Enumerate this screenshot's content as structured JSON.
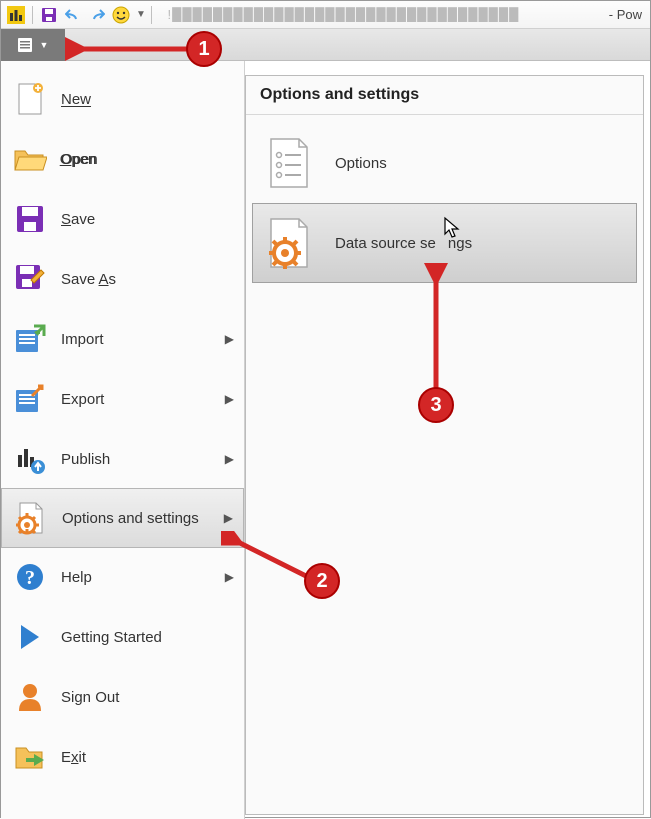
{
  "titlebar": {
    "right_text": "- Pow"
  },
  "menu": {
    "items": [
      {
        "label": "New"
      },
      {
        "label": "Open"
      },
      {
        "label": "Save"
      },
      {
        "label": "Save As"
      },
      {
        "label": "Import"
      },
      {
        "label": "Export"
      },
      {
        "label": "Publish"
      },
      {
        "label": "Options and settings"
      },
      {
        "label": "Help"
      },
      {
        "label": "Getting Started"
      },
      {
        "label": "Sign Out"
      },
      {
        "label": "Exit"
      }
    ]
  },
  "panel": {
    "header": "Options and settings",
    "items": [
      {
        "label": "Options"
      },
      {
        "label": "Data source settings"
      }
    ]
  },
  "callouts": {
    "c1": "1",
    "c2": "2",
    "c3": "3"
  }
}
